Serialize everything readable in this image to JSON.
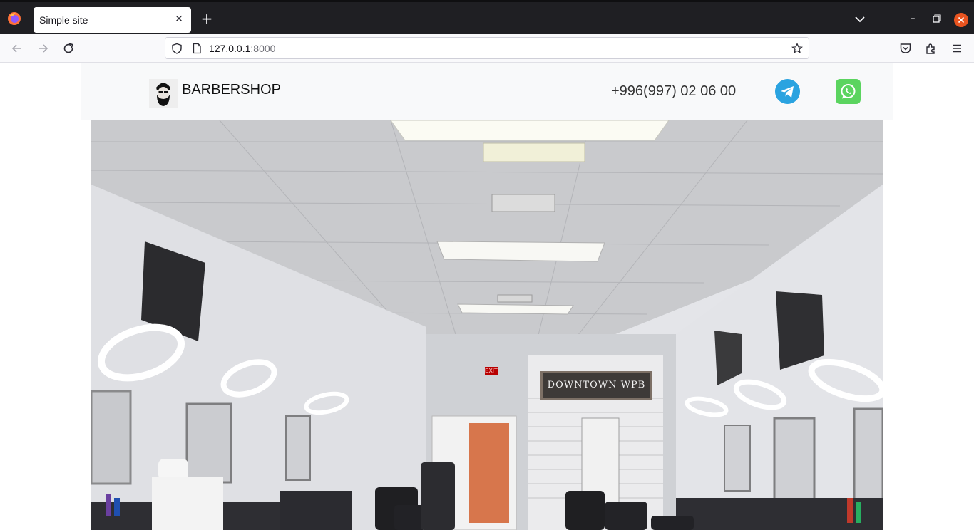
{
  "browser": {
    "tab": {
      "title": "Simple site"
    },
    "url": {
      "host": "127.0.0.1",
      "port": ":8000"
    },
    "icons": [
      "firefox-logo-icon",
      "close-icon",
      "plus-icon",
      "chevron-down-icon",
      "minimize-icon",
      "restore-icon",
      "window-close-icon",
      "back-icon",
      "forward-icon",
      "reload-icon",
      "shield-icon",
      "page-icon",
      "star-icon",
      "pocket-icon",
      "extensions-icon",
      "menu-icon"
    ]
  },
  "site": {
    "brand": "BARBERSHOP",
    "phone": "+996(997) 02 06 00",
    "social": [
      "telegram-icon",
      "whatsapp-icon"
    ],
    "hero": {
      "sign": "DOWNTOWN WPB",
      "exit": "EXIT"
    },
    "colors": {
      "telegram": "#2aa3e0",
      "whatsapp": "#5bd45f",
      "header_bg": "#f8f9fa"
    }
  }
}
